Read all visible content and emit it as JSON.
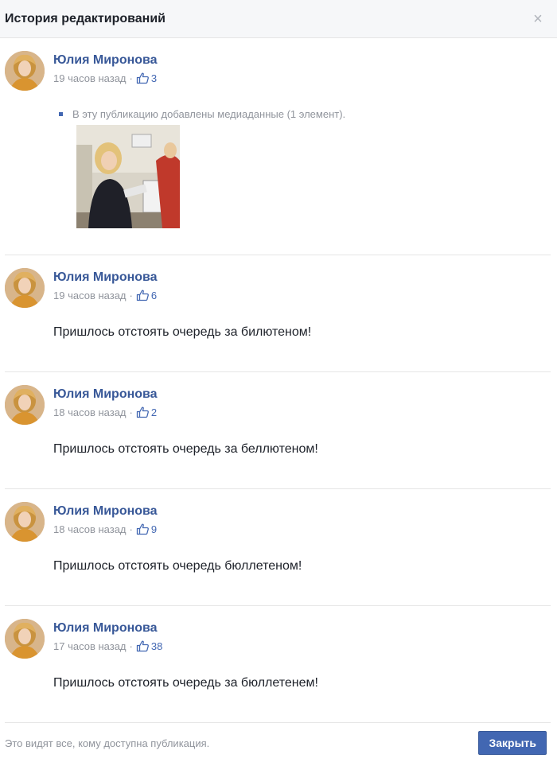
{
  "header": {
    "title": "История редактирований",
    "close_glyph": "×"
  },
  "media_note": "В эту публикацию добавлены медиаданные (1 элемент).",
  "entries": [
    {
      "author": "Юлия Миронова",
      "time": "19 часов назад",
      "likes": "3",
      "text": ""
    },
    {
      "author": "Юлия Миронова",
      "time": "19 часов назад",
      "likes": "6",
      "text": "Пришлось отстоять очередь за билютеном!"
    },
    {
      "author": "Юлия Миронова",
      "time": "18 часов назад",
      "likes": "2",
      "text": "Пришлось отстоять очередь за беллютеном!"
    },
    {
      "author": "Юлия Миронова",
      "time": "18 часов назад",
      "likes": "9",
      "text": "Пришлось отстоять очередь бюллетеном!"
    },
    {
      "author": "Юлия Миронова",
      "time": "17 часов назад",
      "likes": "38",
      "text": "Пришлось отстоять очередь за бюллетенем!"
    }
  ],
  "separator": "·",
  "footer": {
    "note": "Это видят все, кому доступна публикация.",
    "close_label": "Закрыть"
  },
  "colors": {
    "link": "#385898",
    "accent": "#4267b2",
    "muted": "#90949c",
    "header_bg": "#f6f7f9"
  },
  "icons": {
    "like": "thumbs-up-outline-icon",
    "close": "close-icon"
  }
}
